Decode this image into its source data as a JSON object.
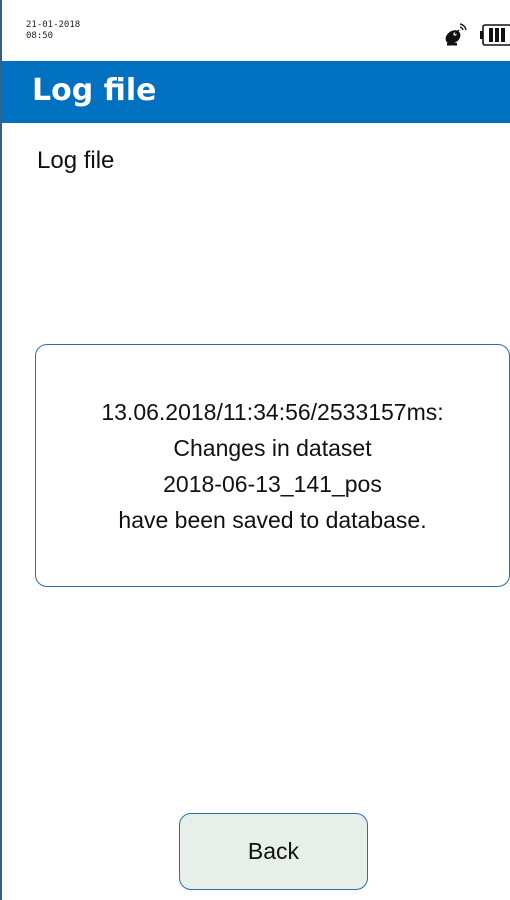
{
  "status_bar": {
    "date": "21-01-2018",
    "time": "08:50",
    "icons": [
      "satellite-icon",
      "battery-icon"
    ]
  },
  "header": {
    "title": "Log file"
  },
  "main": {
    "section_label": "Log file",
    "log_entry": {
      "line1": "13.06.2018/11:34:56/2533157ms:",
      "line2": "Changes in dataset",
      "line3": "2018-06-13_141_pos",
      "line4": "have been saved to database."
    }
  },
  "footer": {
    "back_label": "Back"
  },
  "colors": {
    "title_bar": "#0070c0",
    "border": "#2e6da4",
    "button_bg": "#e6efe9"
  }
}
